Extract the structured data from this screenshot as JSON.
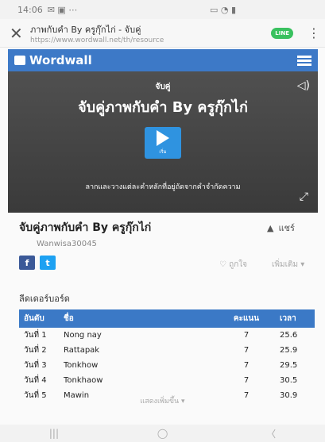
{
  "status_bar": {
    "time": "14:06"
  },
  "browser": {
    "page_title": "ภาพกับคำ By ครูกุ๊กไก่ - จับคู่",
    "url": "https://www.wordwall.net/th/resource",
    "line_badge": "LINE",
    "close_glyph": "✕",
    "menu_glyph": "⋮"
  },
  "wordwall": {
    "brand": "Wordwall"
  },
  "activity": {
    "type_label": "จับคู่",
    "title": "จับคู่ภาพกับคำ By ครูกุ๊กไก่",
    "play_label": "เริ่ม",
    "instruction": "ลากและวางแต่ละคำหลักที่อยู่ถัดจากคำจำกัดความ",
    "sound_glyph": "◁)",
    "fullscreen_glyph": "⤢"
  },
  "resource": {
    "title": "จับคู่ภาพกับคำ By ครูกุ๊กไก่",
    "share_label": "แชร์",
    "author": "Wanwisa30045",
    "like_label": "ถูกใจ",
    "more_label": "เพิ่มเติม",
    "facebook": "f",
    "twitter": "t"
  },
  "leaderboard": {
    "title": "ลีดเดอร์บอร์ด",
    "columns": [
      "อันดับ",
      "ชื่อ",
      "คะแนน",
      "เวลา"
    ],
    "rows": [
      {
        "rank": "วันที่ 1",
        "name": "Nong nay",
        "score": "7",
        "time": "25.6"
      },
      {
        "rank": "วันที่ 2",
        "name": "Rattapak",
        "score": "7",
        "time": "25.9"
      },
      {
        "rank": "วันที่ 3",
        "name": "Tonkhow",
        "score": "7",
        "time": "29.5"
      },
      {
        "rank": "วันที่ 4",
        "name": "Tonkhaow",
        "score": "7",
        "time": "30.5"
      },
      {
        "rank": "วันที่ 5",
        "name": "Mawin",
        "score": "7",
        "time": "30.9"
      }
    ],
    "show_more": "แสดงเพิ่มขึ้น ▾"
  },
  "nav": {
    "recents": "|||",
    "home": "◯",
    "back": "〈"
  }
}
